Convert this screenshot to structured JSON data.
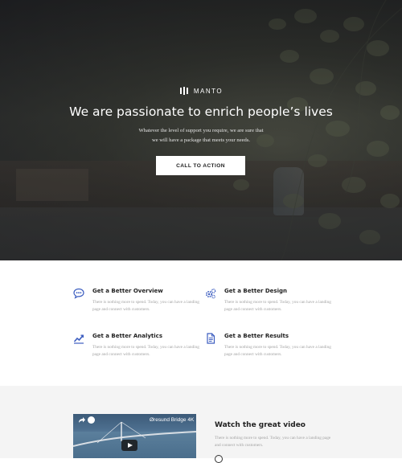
{
  "hero": {
    "brand_name": "MANTO",
    "headline": "We are passionate to enrich people’s lives",
    "subtext_line1": "Whatever the level of support you require, we are sure that",
    "subtext_line2": "we will have a package that meets your needs.",
    "cta_label": "CALL TO ACTION"
  },
  "features": [
    {
      "icon": "chat-bubble-icon",
      "title": "Get a Better Overview",
      "desc": "There is nothing more to spend. Today, you can have a landing page and connect with customers."
    },
    {
      "icon": "gears-icon",
      "title": "Get a Better Design",
      "desc": "There is nothing more to spend. Today, you can have a landing page and connect with customers."
    },
    {
      "icon": "line-chart-icon",
      "title": "Get a Better Analytics",
      "desc": "There is nothing more to spend. Today, you can have a landing page and connect with customers."
    },
    {
      "icon": "document-icon",
      "title": "Get a Better Results",
      "desc": "There is nothing more to spend. Today, you can have a landing page and connect with customers."
    }
  ],
  "video": {
    "player_title": "Øresund Bridge 4K",
    "heading": "Watch the great video",
    "desc": "There is nothing more to spend. Today, you can have a landing page and connect with customers."
  },
  "colors": {
    "accent": "#3d5ec0",
    "hero_text": "#ffffff",
    "muted_text": "#a3a3a3",
    "section_bg": "#f4f4f4"
  }
}
